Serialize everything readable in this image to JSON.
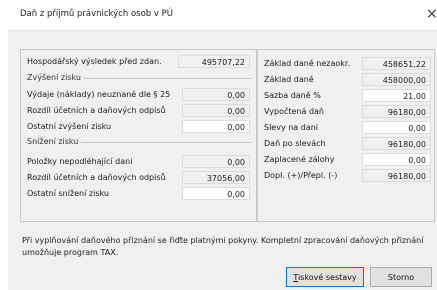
{
  "window": {
    "title": "Daň z příjmů právnických osob v PÚ",
    "close_glyph": "×"
  },
  "left": {
    "vysledek_label": "Hospodářský výsledek před zdan.",
    "vysledek_value": "495707,22",
    "zvyseni": {
      "header": "Zvýšení zisku",
      "rows": [
        {
          "label": "Výdaje (náklady) neuznané dle § 25",
          "value": "0,00"
        },
        {
          "label": "Rozdíl účetních a daňových odpisů",
          "value": "0,00"
        },
        {
          "label": "Ostatní zvýšení zisku",
          "value": "0,00"
        }
      ]
    },
    "snizeni": {
      "header": "Snížení zisku",
      "rows": [
        {
          "label": "Položky nepodléhající dani",
          "value": "0,00"
        },
        {
          "label": "Rozdíl účetních a daňových odpisů",
          "value": "37056,00"
        },
        {
          "label": "Ostatní snížení zisku",
          "value": "0,00"
        }
      ]
    }
  },
  "right": {
    "rows": [
      {
        "label": "Základ daně nezaokr.",
        "value": "458651,22"
      },
      {
        "label": "Základ daně",
        "value": "458000,00"
      },
      {
        "label": "Sazba daně %",
        "value": "21,00"
      },
      {
        "label": "Vypočtená daň",
        "value": "96180,00"
      },
      {
        "label": "Slevy na dani",
        "value": "0,00"
      },
      {
        "label": "Daň po slevách",
        "value": "96180,00"
      },
      {
        "label": "Zaplacené zálohy",
        "value": "0,00"
      },
      {
        "label": "Dopl. (+)/Přepl. (-)",
        "value": "96180,00"
      }
    ]
  },
  "info_text": "Při vyplňování daňového přiznání se řiďte platnými pokyny. Kompletní zpracování daňových přiznání umožňuje program TAX.",
  "buttons": {
    "tiskove_hotkey": "T",
    "tiskove_rest": "iskové sestavy",
    "storno": "Storno"
  }
}
